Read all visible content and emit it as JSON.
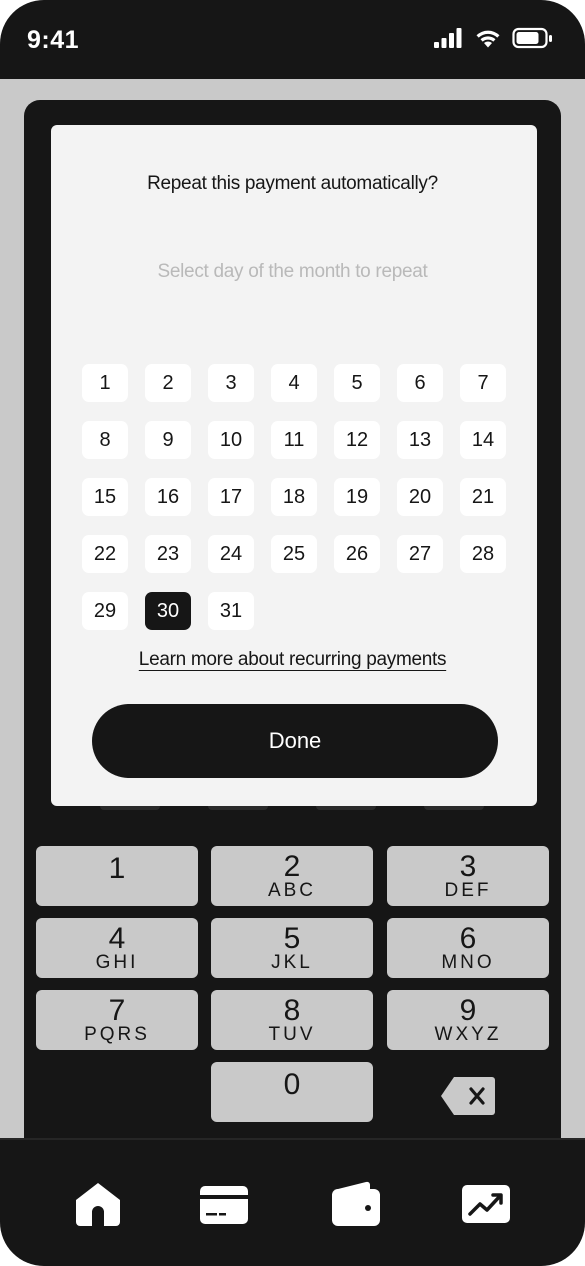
{
  "status_bar": {
    "time": "9:41",
    "icons": [
      "cellular-signal-icon",
      "wifi-icon",
      "battery-icon"
    ]
  },
  "modal": {
    "title": "Repeat this payment automatically?",
    "subtitle": "Select day of the month to repeat",
    "days": [
      "1",
      "2",
      "3",
      "4",
      "5",
      "6",
      "7",
      "8",
      "9",
      "10",
      "11",
      "12",
      "13",
      "14",
      "15",
      "16",
      "17",
      "18",
      "19",
      "20",
      "21",
      "22",
      "23",
      "24",
      "25",
      "26",
      "27",
      "28",
      "29",
      "30",
      "31"
    ],
    "selected_day": "30",
    "learn_more_link": "Learn more about recurring payments",
    "done_button": "Done"
  },
  "keypad": {
    "keys": [
      {
        "digit": "1",
        "letters": ""
      },
      {
        "digit": "2",
        "letters": "ABC"
      },
      {
        "digit": "3",
        "letters": "DEF"
      },
      {
        "digit": "4",
        "letters": "GHI"
      },
      {
        "digit": "5",
        "letters": "JKL"
      },
      {
        "digit": "6",
        "letters": "MNO"
      },
      {
        "digit": "7",
        "letters": "PQRS"
      },
      {
        "digit": "8",
        "letters": "TUV"
      },
      {
        "digit": "9",
        "letters": "WXYZ"
      },
      {
        "digit": "0",
        "letters": ""
      }
    ],
    "backspace_icon": "backspace-icon"
  },
  "tab_bar": {
    "tabs": [
      {
        "icon": "home-icon"
      },
      {
        "icon": "card-icon"
      },
      {
        "icon": "wallet-icon"
      },
      {
        "icon": "trending-up-icon"
      }
    ]
  },
  "colors": {
    "dark": "#161616",
    "frame": "#c9c9c9",
    "modal_bg": "#f3f3f3",
    "muted_text": "#b9b9b9"
  }
}
